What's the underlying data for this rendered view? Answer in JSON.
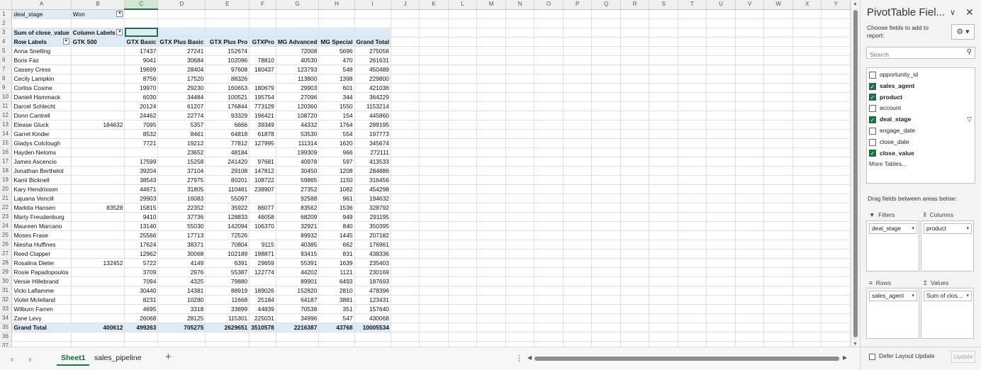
{
  "columns": [
    "",
    "A",
    "B",
    "C",
    "D",
    "E",
    "F",
    "G",
    "H",
    "I",
    "J",
    "K",
    "L",
    "M",
    "N",
    "O",
    "P",
    "Q",
    "R",
    "S",
    "T",
    "U",
    "V",
    "W",
    "X",
    "Y"
  ],
  "selected_column": "C",
  "filter_row": {
    "field": "deal_stage",
    "value": "Won"
  },
  "pivot": {
    "corner_label": "Sum of close_value",
    "column_labels": "Column Labels",
    "row_labels": "Row Labels",
    "column_headers": [
      "GTK 500",
      "GTX Basic",
      "GTX Plus Basic",
      "GTX Plus Pro",
      "GTXPro",
      "MG Advanced",
      "MG Special",
      "Grand Total"
    ],
    "rows": [
      {
        "name": "Anna Snelling",
        "values": [
          "",
          "17437",
          "27241",
          "152674",
          "",
          "72008",
          "5696",
          "275056"
        ]
      },
      {
        "name": "Boris Faz",
        "values": [
          "",
          "9041",
          "30684",
          "102096",
          "78810",
          "40530",
          "470",
          "261631"
        ]
      },
      {
        "name": "Cassey Cress",
        "values": [
          "",
          "19699",
          "28404",
          "97608",
          "180437",
          "123793",
          "548",
          "450489"
        ]
      },
      {
        "name": "Cecily Lampkin",
        "values": [
          "",
          "8756",
          "17520",
          "88326",
          "",
          "113800",
          "1398",
          "229800"
        ]
      },
      {
        "name": "Corliss Cosme",
        "values": [
          "",
          "19970",
          "29230",
          "160653",
          "180679",
          "29903",
          "601",
          "421036"
        ]
      },
      {
        "name": "Daniell Hammack",
        "values": [
          "",
          "6030",
          "34484",
          "100521",
          "195754",
          "27096",
          "344",
          "364229"
        ]
      },
      {
        "name": "Darcel Schlecht",
        "values": [
          "",
          "20124",
          "61207",
          "176844",
          "773129",
          "120360",
          "1550",
          "1153214"
        ]
      },
      {
        "name": "Donn Cantrell",
        "values": [
          "",
          "24462",
          "22774",
          "93329",
          "196421",
          "108720",
          "154",
          "445860"
        ]
      },
      {
        "name": "Elease Gluck",
        "values": [
          "184632",
          "7095",
          "5357",
          "6666",
          "39349",
          "44332",
          "1764",
          "289195"
        ]
      },
      {
        "name": "Garret Kinder",
        "values": [
          "",
          "8532",
          "8461",
          "64818",
          "61878",
          "53530",
          "554",
          "197773"
        ]
      },
      {
        "name": "Gladys Colclough",
        "values": [
          "",
          "7721",
          "19212",
          "77812",
          "127995",
          "111314",
          "1620",
          "345674"
        ]
      },
      {
        "name": "Hayden Neloms",
        "values": [
          "",
          "",
          "23652",
          "48184",
          "",
          "199309",
          "966",
          "272111"
        ]
      },
      {
        "name": "James Ascencio",
        "values": [
          "",
          "17599",
          "15258",
          "241420",
          "97681",
          "40978",
          "597",
          "413533"
        ]
      },
      {
        "name": "Jonathan Berthelot",
        "values": [
          "",
          "39204",
          "37104",
          "29108",
          "147812",
          "30450",
          "1208",
          "284886"
        ]
      },
      {
        "name": "Kami Bicknell",
        "values": [
          "",
          "38543",
          "27975",
          "80201",
          "108722",
          "59865",
          "1150",
          "316456"
        ]
      },
      {
        "name": "Kary Hendrixson",
        "values": [
          "",
          "44671",
          "31805",
          "110481",
          "238907",
          "27352",
          "1082",
          "454298"
        ]
      },
      {
        "name": "Lajuana Vencill",
        "values": [
          "",
          "29903",
          "16083",
          "55097",
          "",
          "92588",
          "961",
          "194632"
        ]
      },
      {
        "name": "Markita Hansen",
        "values": [
          "83528",
          "15815",
          "22352",
          "35922",
          "86077",
          "83562",
          "1536",
          "328792"
        ]
      },
      {
        "name": "Marty Freudenburg",
        "values": [
          "",
          "9410",
          "37736",
          "128833",
          "46058",
          "68209",
          "949",
          "291195"
        ]
      },
      {
        "name": "Maureen Marcano",
        "values": [
          "",
          "13140",
          "55030",
          "142094",
          "106370",
          "32921",
          "840",
          "350395"
        ]
      },
      {
        "name": "Moses Frase",
        "values": [
          "",
          "25566",
          "17713",
          "72526",
          "",
          "89932",
          "1445",
          "207182"
        ]
      },
      {
        "name": "Niesha Huffines",
        "values": [
          "",
          "17624",
          "38371",
          "70804",
          "9115",
          "40385",
          "662",
          "176961"
        ]
      },
      {
        "name": "Reed Clapper",
        "values": [
          "",
          "12962",
          "30068",
          "102189",
          "198871",
          "93415",
          "831",
          "438336"
        ]
      },
      {
        "name": "Rosalina Dieter",
        "values": [
          "132452",
          "5722",
          "4149",
          "6391",
          "29659",
          "55391",
          "1639",
          "235403"
        ]
      },
      {
        "name": "Rosie Papadopoulos",
        "values": [
          "",
          "3709",
          "2976",
          "55387",
          "122774",
          "44202",
          "1121",
          "230169"
        ]
      },
      {
        "name": "Versie Hillebrand",
        "values": [
          "",
          "7094",
          "4325",
          "79880",
          "",
          "89901",
          "6493",
          "187693"
        ]
      },
      {
        "name": "Vicki Laflamme",
        "values": [
          "",
          "30440",
          "14381",
          "88919",
          "189026",
          "152820",
          "2810",
          "478396"
        ]
      },
      {
        "name": "Violet Mclelland",
        "values": [
          "",
          "8231",
          "10280",
          "11668",
          "25184",
          "64187",
          "3881",
          "123431"
        ]
      },
      {
        "name": "Wilburn Farren",
        "values": [
          "",
          "4695",
          "3318",
          "33899",
          "44839",
          "70538",
          "351",
          "157640"
        ]
      },
      {
        "name": "Zane Levy",
        "values": [
          "",
          "26068",
          "28125",
          "115301",
          "225031",
          "34996",
          "547",
          "430068"
        ]
      }
    ],
    "grand_total": {
      "name": "Grand Total",
      "values": [
        "400612",
        "499263",
        "705275",
        "2629651",
        "3510578",
        "2216387",
        "43768",
        "10005534"
      ]
    }
  },
  "sheets": {
    "nav_prev": "‹",
    "nav_next": "›",
    "tabs": [
      "Sheet1",
      "sales_pipeline"
    ],
    "active": "Sheet1",
    "add": "+",
    "more": "⋮"
  },
  "pane": {
    "title": "PivotTable Fiel...",
    "choose_label": "Choose fields to add to report:",
    "gear": "⚙ ▾",
    "search_placeholder": "Search",
    "fields": [
      {
        "name": "opportunity_id",
        "checked": false,
        "filtered": false
      },
      {
        "name": "sales_agent",
        "checked": true,
        "filtered": false
      },
      {
        "name": "product",
        "checked": true,
        "filtered": false
      },
      {
        "name": "account",
        "checked": false,
        "filtered": false
      },
      {
        "name": "deal_stage",
        "checked": true,
        "filtered": true
      },
      {
        "name": "engage_date",
        "checked": false,
        "filtered": false
      },
      {
        "name": "close_date",
        "checked": false,
        "filtered": false
      },
      {
        "name": "close_value",
        "checked": true,
        "filtered": false
      }
    ],
    "more_tables": "More Tables...",
    "drag_label": "Drag fields between areas below:",
    "areas": {
      "filters": {
        "label": "Filters",
        "icon": "▼",
        "item": "deal_stage"
      },
      "columns": {
        "label": "Columns",
        "icon": "⦀",
        "item": "product"
      },
      "rows": {
        "label": "Rows",
        "icon": "≡",
        "item": "sales_agent"
      },
      "values": {
        "label": "Values",
        "icon": "Σ",
        "item": "Sum of clos..."
      }
    },
    "defer_label": "Defer Layout Update",
    "update_label": "Update"
  },
  "colors": {
    "accent": "#1e7145",
    "pivot_header_bg": "#ddebf7",
    "pivot_border": "#9bc2e6"
  }
}
